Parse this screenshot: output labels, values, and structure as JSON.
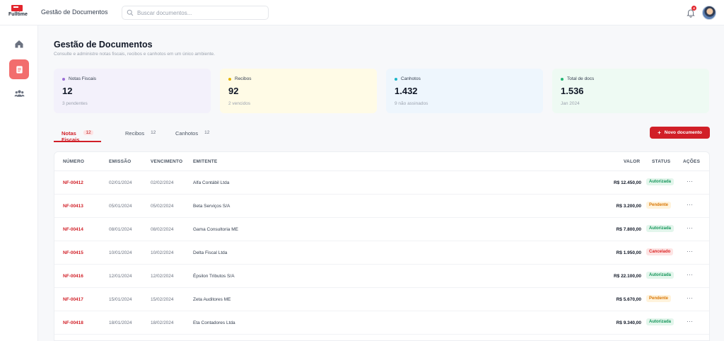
{
  "brand": {
    "name": "Fulltime"
  },
  "app": {
    "title": "Gestão de Documentos"
  },
  "search": {
    "placeholder": "Buscar documentos..."
  },
  "notifications": {
    "count": "4"
  },
  "sidebar": {
    "items": [
      {
        "icon": "home-icon"
      },
      {
        "icon": "document-icon",
        "active": true
      },
      {
        "icon": "users-icon"
      }
    ]
  },
  "header": {
    "title": "Gestão de Documentos",
    "subtitle": "Consulte e administre notas fiscais, recibos e canhotos em um único ambiente."
  },
  "cards": [
    {
      "label": "Notas Fiscais",
      "value": "12",
      "sub": "3 pendentes",
      "bg": "#f3f1fb",
      "dot": "#9b6fd6"
    },
    {
      "label": "Recibos",
      "value": "92",
      "sub": "2 vencidos",
      "bg": "#fffbe6",
      "dot": "#e5b400"
    },
    {
      "label": "Canhotos",
      "value": "1.432",
      "sub": "9 não assinados",
      "bg": "#eef6fd",
      "dot": "#1cb5c8"
    },
    {
      "label": "Total de docs",
      "value": "1.536",
      "sub": "Jan 2024",
      "bg": "#eefaf3",
      "dot": "#22b573"
    }
  ],
  "tabs": [
    {
      "label": "Notas Fiscais",
      "count": "12",
      "active": true
    },
    {
      "label": "Recibos",
      "count": "12"
    },
    {
      "label": "Canhotos",
      "count": "12"
    }
  ],
  "new_button": {
    "label": "Novo documento"
  },
  "table": {
    "columns": [
      "NÚMERO",
      "EMISSÃO",
      "VENCIMENTO",
      "EMITENTE",
      "VALOR",
      "STATUS",
      "AÇÕES"
    ],
    "rows": [
      {
        "id": "NF-00412",
        "emissao": "02/01/2024",
        "vencimento": "02/02/2024",
        "emitente": "Alfa Contábil Ltda",
        "valor": "R$ 12.450,00",
        "status": "Autorizada"
      },
      {
        "id": "NF-00413",
        "emissao": "05/01/2024",
        "vencimento": "05/02/2024",
        "emitente": "Beta Serviços S/A",
        "valor": "R$ 3.200,00",
        "status": "Pendente"
      },
      {
        "id": "NF-00414",
        "emissao": "08/01/2024",
        "vencimento": "08/02/2024",
        "emitente": "Gama Consultoria ME",
        "valor": "R$ 7.800,00",
        "status": "Autorizada"
      },
      {
        "id": "NF-00415",
        "emissao": "10/01/2024",
        "vencimento": "10/02/2024",
        "emitente": "Delta Fiscal Ltda",
        "valor": "R$ 1.950,00",
        "status": "Cancelado"
      },
      {
        "id": "NF-00416",
        "emissao": "12/01/2024",
        "vencimento": "12/02/2024",
        "emitente": "Épsilon Tributos S/A",
        "valor": "R$ 22.100,00",
        "status": "Autorizada"
      },
      {
        "id": "NF-00417",
        "emissao": "15/01/2024",
        "vencimento": "15/02/2024",
        "emitente": "Zeta Auditores ME",
        "valor": "R$ 5.670,00",
        "status": "Pendente"
      },
      {
        "id": "NF-00418",
        "emissao": "18/01/2024",
        "vencimento": "18/02/2024",
        "emitente": "Eta Contadores Ltda",
        "valor": "R$ 9.340,00",
        "status": "Autorizada"
      }
    ]
  },
  "colors": {
    "accent": "#d11f27",
    "ok": "#15965a",
    "pending": "#d97706",
    "cancel": "#dc2626"
  }
}
